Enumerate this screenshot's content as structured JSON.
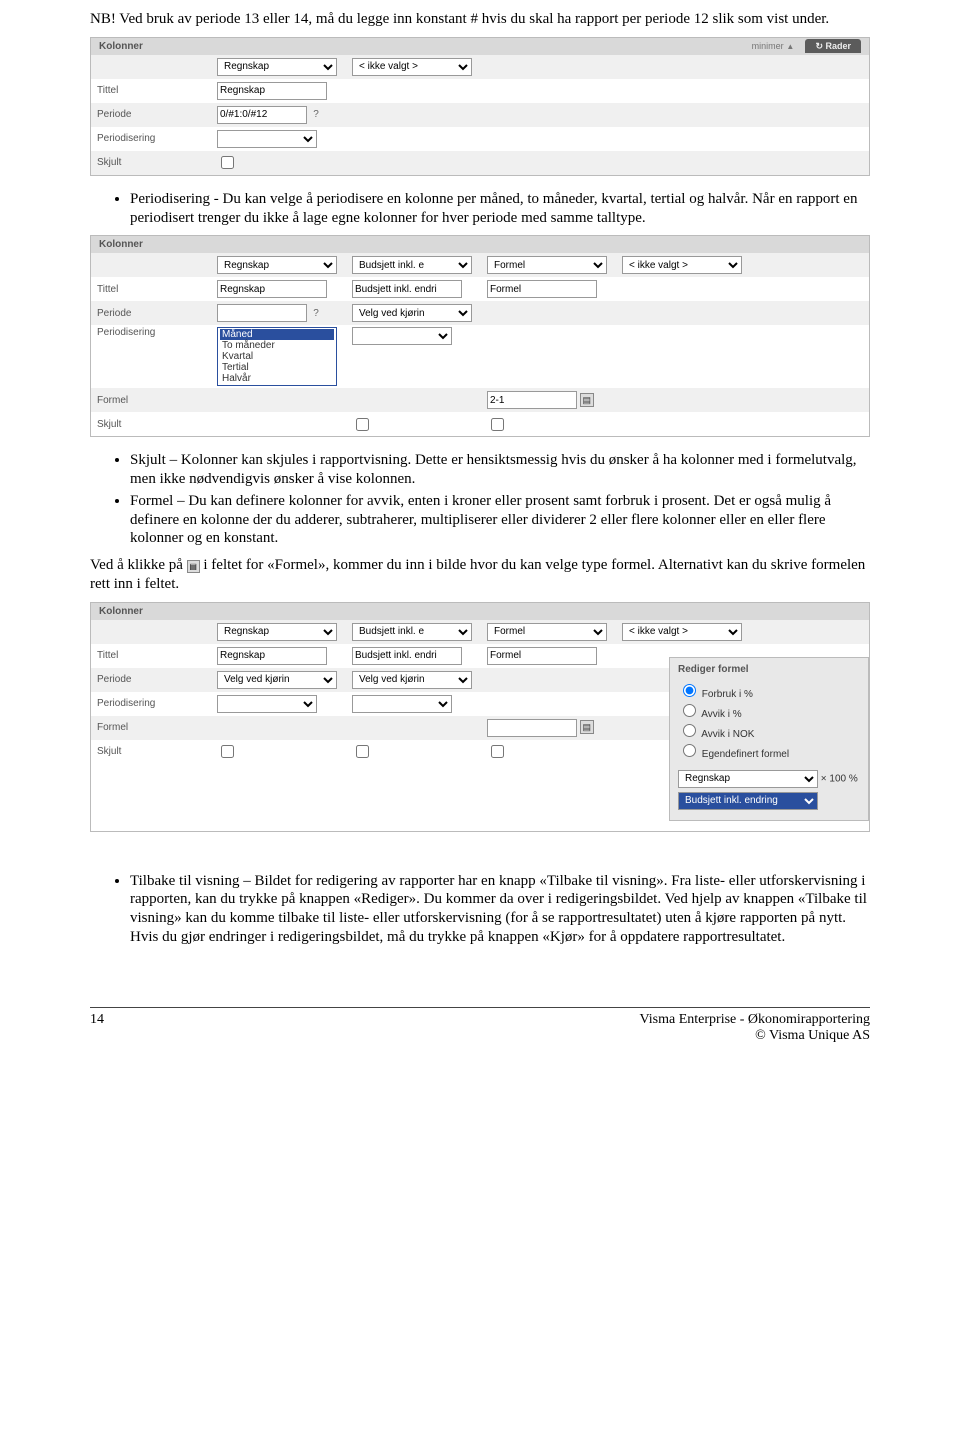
{
  "intro_para": "NB! Ved bruk av periode 13 eller 14, må du legge inn konstant # hvis du skal ha rapport per periode 12 slik som vist under.",
  "ss1": {
    "header": "Kolonner",
    "minimer": "minimer",
    "rader_tab": "Rader",
    "rows": {
      "dropdown_row": {
        "val": "Regnskap",
        "opt2": "< ikke valgt >"
      },
      "tittel": {
        "label": "Tittel",
        "val": "Regnskap"
      },
      "periode": {
        "label": "Periode",
        "val": "0/#1:0/#12"
      },
      "periodisering": {
        "label": "Periodisering",
        "val": ""
      },
      "skjult": {
        "label": "Skjult"
      }
    }
  },
  "bullet_periodisering": "Periodisering - Du kan velge å periodisere en kolonne per måned, to måneder, kvartal, tertial og halvår. Når en rapport en periodisert trenger du ikke å lage egne kolonner for hver periode med samme talltype.",
  "ss2": {
    "header": "Kolonner",
    "row0": {
      "c1": "Regnskap",
      "c2": "Budsjett inkl. e",
      "c3": "Formel",
      "c4": "< ikke valgt >"
    },
    "tittel": {
      "label": "Tittel",
      "c1": "Regnskap",
      "c2": "Budsjett inkl. endri",
      "c3": "Formel"
    },
    "periode": {
      "label": "Periode",
      "c2": "Velg ved kjørin"
    },
    "periodisering": {
      "label": "Periodisering"
    },
    "formel": {
      "label": "Formel",
      "c3": "2-1"
    },
    "skjult": {
      "label": "Skjult"
    },
    "dd_options": [
      "Måned",
      "To måneder",
      "Kvartal",
      "Tertial",
      "Halvår"
    ],
    "dd_selected": "Måned"
  },
  "bullets_mid": [
    "Skjult – Kolonner kan skjules i rapportvisning. Dette er hensiktsmessig hvis du ønsker å ha kolonner med i formelutvalg, men ikke nødvendigvis ønsker å vise kolonnen.",
    "Formel – Du kan definere kolonner for avvik, enten i kroner eller prosent samt forbruk i prosent. Det er også mulig å definere en kolonne der du adderer, subtraherer, multipliserer eller dividerer 2 eller flere kolonner eller en eller flere kolonner og en konstant."
  ],
  "formel_para_a": "Ved å klikke på ",
  "formel_para_b": " i feltet for «Formel», kommer du inn i bilde hvor du kan velge type formel. Alternativt kan du skrive formelen rett inn i feltet.",
  "ss3": {
    "header": "Kolonner",
    "row0": {
      "c1": "Regnskap",
      "c2": "Budsjett inkl. e",
      "c3": "Formel",
      "c4": "< ikke valgt >"
    },
    "tittel": {
      "label": "Tittel",
      "c1": "Regnskap",
      "c2": "Budsjett inkl. endri",
      "c3": "Formel"
    },
    "periode": {
      "label": "Periode",
      "c1": "Velg ved kjørin",
      "c2": "Velg ved kjørin"
    },
    "periodisering": {
      "label": "Periodisering"
    },
    "formel": {
      "label": "Formel"
    },
    "skjult": {
      "label": "Skjult"
    },
    "rf": {
      "title": "Rediger formel",
      "opt1": "Forbruk i %",
      "opt2": "Avvik i %",
      "opt3": "Avvik i NOK",
      "opt4": "Egendefinert formel",
      "sel1": "Regnskap",
      "mult": "× 100 %",
      "sel2": "Budsjett inkl. endring"
    }
  },
  "bullet_tilbake": "Tilbake til visning – Bildet for redigering av rapporter har en knapp «Tilbake til visning». Fra liste- eller utforskervisning i rapporten, kan du trykke på knappen «Rediger». Du kommer da over i redigeringsbildet. Ved hjelp av knappen «Tilbake til visning» kan du komme tilbake til liste- eller utforskervisning (for å se rapportresultatet) uten å kjøre rapporten på nytt. Hvis du gjør endringer i redigeringsbildet, må du trykke på knappen «Kjør» for å oppdatere rapportresultatet.",
  "footer": {
    "page": "14",
    "line1": "Visma Enterprise - Økonomirapportering",
    "line2": "© Visma Unique AS"
  }
}
